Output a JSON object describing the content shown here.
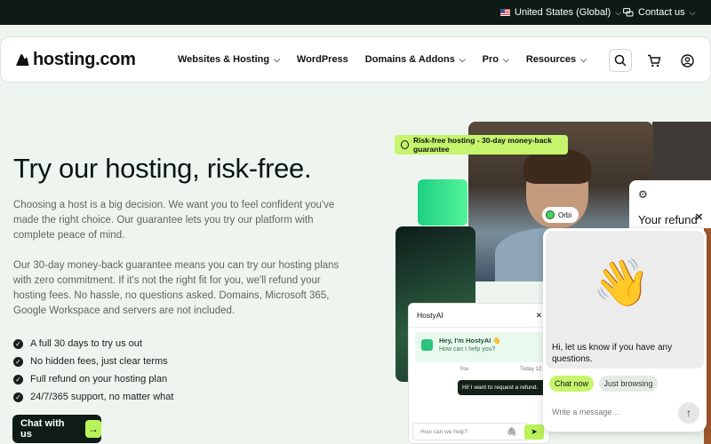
{
  "topbar": {
    "region": "United States (Global)",
    "contact": "Contact us"
  },
  "nav": {
    "logo_text": "hosting.com",
    "items": [
      {
        "label": "Websites & Hosting",
        "has_dropdown": true
      },
      {
        "label": "WordPress",
        "has_dropdown": false
      },
      {
        "label": "Domains & Addons",
        "has_dropdown": true
      },
      {
        "label": "Pro",
        "has_dropdown": true
      },
      {
        "label": "Resources",
        "has_dropdown": true
      }
    ],
    "icons": [
      "search-icon",
      "cart-icon",
      "account-icon"
    ]
  },
  "hero": {
    "title": "Try our hosting, risk-free.",
    "paragraph1": "Choosing a host is a big decision. We want you to feel confident you've made the right choice. Our guarantee lets you try our platform with complete peace of mind.",
    "paragraph2": "Our 30-day money-back guarantee means you can try our hosting plans with zero commitment. If it's not the right fit for you, we'll refund your hosting fees. No hassle, no questions asked. Domains, Microsoft 365, Google Workspace and servers are not included.",
    "checks": [
      "A full 30 days to try us out",
      "No hidden fees, just clear terms",
      "Full refund on your hosting plan",
      "24/7/365 support, no matter what"
    ],
    "cta_label": "Chat with us"
  },
  "collage": {
    "badge": "Risk-free hosting - 30-day money-back guarantee",
    "orbi_label": "Orbi",
    "refund_card_text": "Your refund",
    "hosty": {
      "title": "HostyAI",
      "greeting_title": "Hey, I'm HostyAI 👋",
      "greeting_sub": "How can I help you?",
      "you_label": "You",
      "time_label": "Today 12",
      "user_message": "Hi! I want to request a refund.",
      "input_placeholder": "How can we help?"
    }
  },
  "chat_widget": {
    "message": "Hi, let us know if you have any questions.",
    "button_primary": "Chat now",
    "button_secondary": "Just browsing",
    "input_placeholder": "Write a message…"
  },
  "colors": {
    "accent_lime": "#c6f46c",
    "dark": "#0f1c15",
    "page_bg": "#eef5ee"
  }
}
